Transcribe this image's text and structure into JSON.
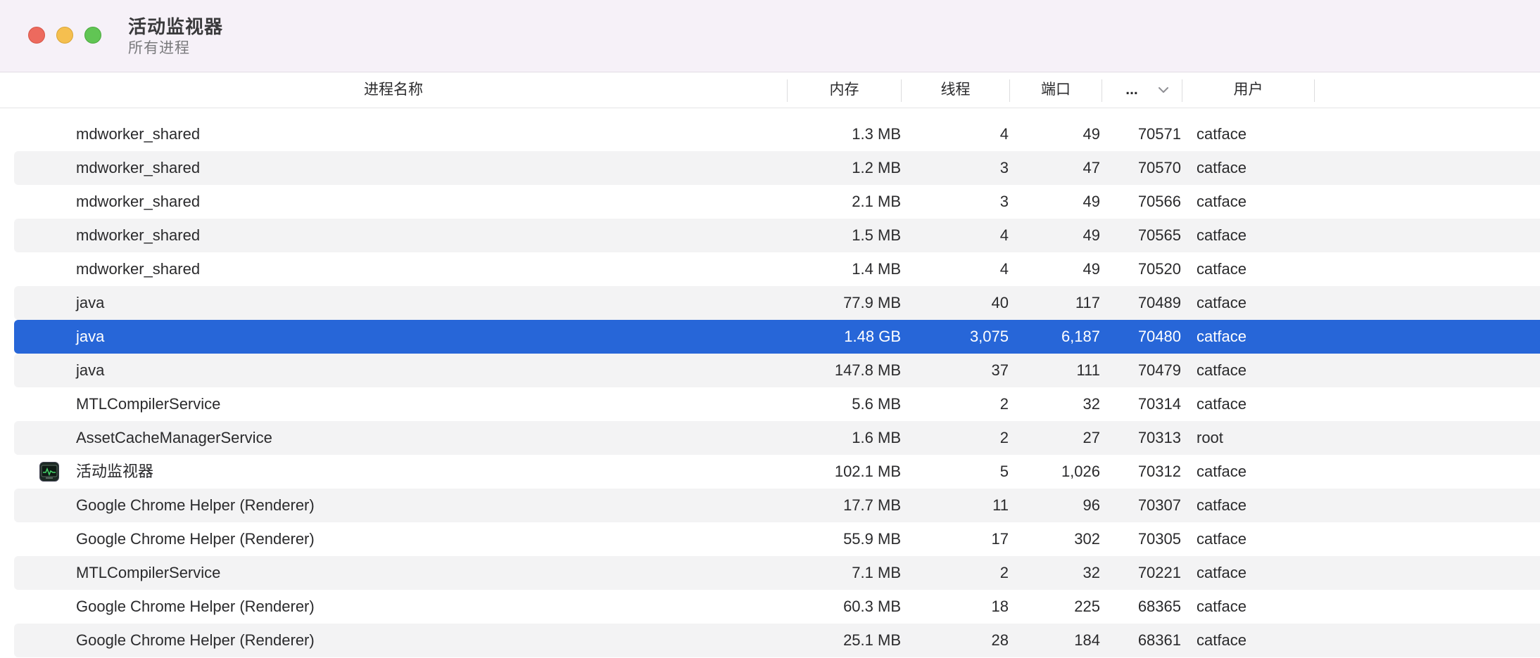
{
  "window": {
    "title": "活动监视器",
    "subtitle": "所有进程"
  },
  "columns": {
    "name": "进程名称",
    "memory": "内存",
    "threads": "线程",
    "ports": "端口",
    "pid": "...",
    "user": "用户"
  },
  "icons": {
    "close": "close-icon",
    "minimize": "minimize-icon",
    "zoom": "zoom-icon",
    "sort": "chevron-down-icon",
    "activity_monitor": "activity-monitor-icon"
  },
  "colors": {
    "selection": "#2766d8",
    "alt_row": "#f3f3f4",
    "titlebar": "#f6f1f8"
  },
  "rows": [
    {
      "name": "mdworker_shared",
      "memory": "1.3 MB",
      "threads": "4",
      "ports": "49",
      "pid": "70571",
      "user": "catface"
    },
    {
      "name": "mdworker_shared",
      "memory": "1.2 MB",
      "threads": "3",
      "ports": "47",
      "pid": "70570",
      "user": "catface"
    },
    {
      "name": "mdworker_shared",
      "memory": "2.1 MB",
      "threads": "3",
      "ports": "49",
      "pid": "70566",
      "user": "catface"
    },
    {
      "name": "mdworker_shared",
      "memory": "1.5 MB",
      "threads": "4",
      "ports": "49",
      "pid": "70565",
      "user": "catface"
    },
    {
      "name": "mdworker_shared",
      "memory": "1.4 MB",
      "threads": "4",
      "ports": "49",
      "pid": "70520",
      "user": "catface"
    },
    {
      "name": "java",
      "memory": "77.9 MB",
      "threads": "40",
      "ports": "117",
      "pid": "70489",
      "user": "catface"
    },
    {
      "name": "java",
      "memory": "1.48 GB",
      "threads": "3,075",
      "ports": "6,187",
      "pid": "70480",
      "user": "catface",
      "selected": true
    },
    {
      "name": "java",
      "memory": "147.8 MB",
      "threads": "37",
      "ports": "111",
      "pid": "70479",
      "user": "catface"
    },
    {
      "name": "MTLCompilerService",
      "memory": "5.6 MB",
      "threads": "2",
      "ports": "32",
      "pid": "70314",
      "user": "catface"
    },
    {
      "name": "AssetCacheManagerService",
      "memory": "1.6 MB",
      "threads": "2",
      "ports": "27",
      "pid": "70313",
      "user": "root"
    },
    {
      "name": "活动监视器",
      "memory": "102.1 MB",
      "threads": "5",
      "ports": "1,026",
      "pid": "70312",
      "user": "catface",
      "icon": "activity-monitor-icon"
    },
    {
      "name": "Google Chrome Helper (Renderer)",
      "memory": "17.7 MB",
      "threads": "11",
      "ports": "96",
      "pid": "70307",
      "user": "catface"
    },
    {
      "name": "Google Chrome Helper (Renderer)",
      "memory": "55.9 MB",
      "threads": "17",
      "ports": "302",
      "pid": "70305",
      "user": "catface"
    },
    {
      "name": "MTLCompilerService",
      "memory": "7.1 MB",
      "threads": "2",
      "ports": "32",
      "pid": "70221",
      "user": "catface"
    },
    {
      "name": "Google Chrome Helper (Renderer)",
      "memory": "60.3 MB",
      "threads": "18",
      "ports": "225",
      "pid": "68365",
      "user": "catface"
    },
    {
      "name": "Google Chrome Helper (Renderer)",
      "memory": "25.1 MB",
      "threads": "28",
      "ports": "184",
      "pid": "68361",
      "user": "catface"
    }
  ]
}
